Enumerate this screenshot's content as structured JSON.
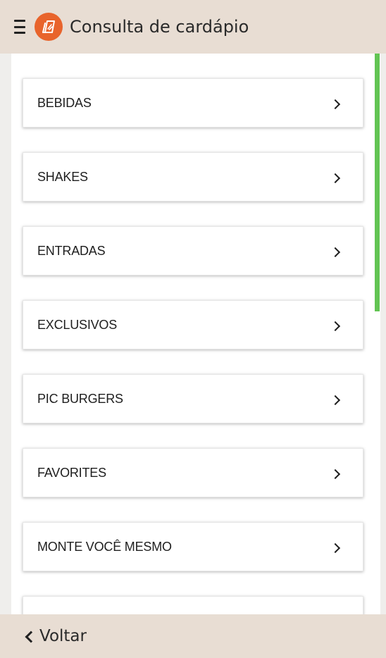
{
  "header": {
    "title": "Consulta de cardápio",
    "logo_color": "#e8642c"
  },
  "menu": {
    "items": [
      {
        "label": "BEBIDAS"
      },
      {
        "label": "SHAKES"
      },
      {
        "label": "ENTRADAS"
      },
      {
        "label": "EXCLUSIVOS"
      },
      {
        "label": "PIC BURGERS"
      },
      {
        "label": "FAVORITES"
      },
      {
        "label": "MONTE VOCÊ MESMO"
      },
      {
        "label": ""
      }
    ]
  },
  "footer": {
    "back_label": "Voltar"
  },
  "colors": {
    "header_bg": "#e8ddd3",
    "scrollbar": "#62c453",
    "accent": "#e8642c"
  }
}
